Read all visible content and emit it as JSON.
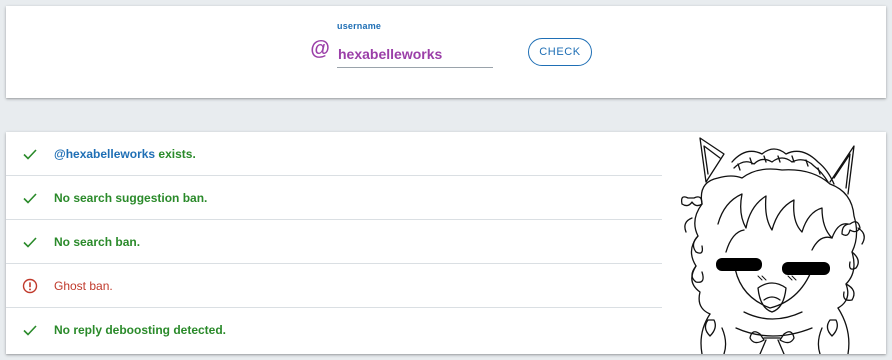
{
  "search": {
    "label": "username",
    "at_symbol": "@",
    "value": "hexabelleworks",
    "button_label": "CHECK"
  },
  "results": [
    {
      "status": "ok",
      "handle": "@hexabelleworks",
      "text": " exists."
    },
    {
      "status": "ok",
      "text": "No search suggestion ban."
    },
    {
      "status": "ok",
      "text": "No search ban."
    },
    {
      "status": "error",
      "text": "Ghost ban."
    },
    {
      "status": "ok",
      "text": "No reply deboosting detected."
    }
  ],
  "colors": {
    "ok": "#2a8a2a",
    "error": "#c0392b",
    "accent": "#1f6fb5",
    "username": "#9b3fa8"
  },
  "icons": {
    "ok": "check-icon",
    "error": "alert-circle-icon",
    "at": "at-icon"
  }
}
